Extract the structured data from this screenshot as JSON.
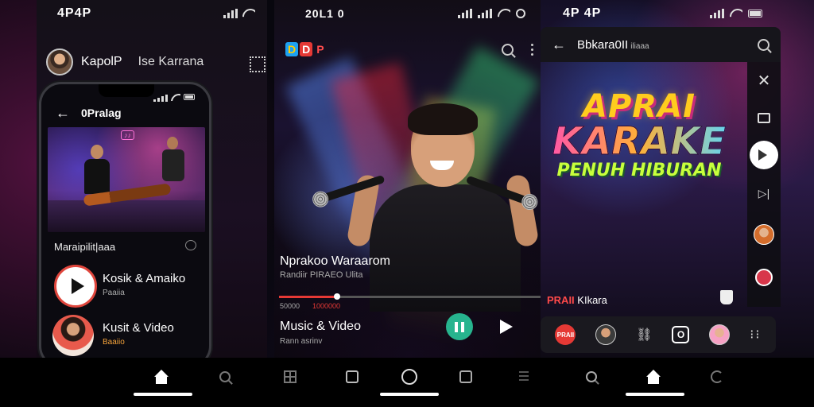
{
  "status_bars": {
    "left_time": "4P4P",
    "center_time": "20L1 0",
    "right_time": "4P 4P"
  },
  "left_panel": {
    "header_name": "KapolP",
    "header_subname": "Ise Karrana",
    "phone": {
      "title": "0Pralag"
    },
    "section_label": "Maraipilit|aaa",
    "items": [
      {
        "title": "Kosik & Amaiko",
        "subtitle": "Paaiia"
      },
      {
        "title": "Kusit & Video",
        "subtitle": "Baaiio"
      }
    ]
  },
  "center_panel": {
    "logo": [
      "D",
      "D",
      "P"
    ],
    "now_playing": {
      "title": "Nprakoo Waraarom",
      "subtitle": "Randiir PIRAEO Ulita",
      "time_current": "50000",
      "time_total": "1000000",
      "progress": 0.22
    },
    "music_video": {
      "title": "Music & Video",
      "subtitle": "Rann asrinv"
    }
  },
  "right_panel": {
    "title": "Bbkara0II",
    "title_small": "iliaaa",
    "headline": {
      "line1": "APRAI",
      "line2": "KARAKE",
      "line3": "PENUH HIBURAN"
    },
    "label_red": "PRAII",
    "label_white": "KIkara",
    "dock_badge": "PRAII"
  },
  "colors": {
    "accent_red": "#e53935",
    "accent_green": "#27b48e",
    "title_yellow": "#ffcc1e",
    "title_lime": "#c8ff3c"
  },
  "icons": {
    "nav": [
      "home-icon",
      "search-icon",
      "grid-icon",
      "share-icon",
      "music-note-icon",
      "box-icon",
      "menu-icon",
      "search-icon",
      "home-icon",
      "refresh-icon"
    ]
  }
}
